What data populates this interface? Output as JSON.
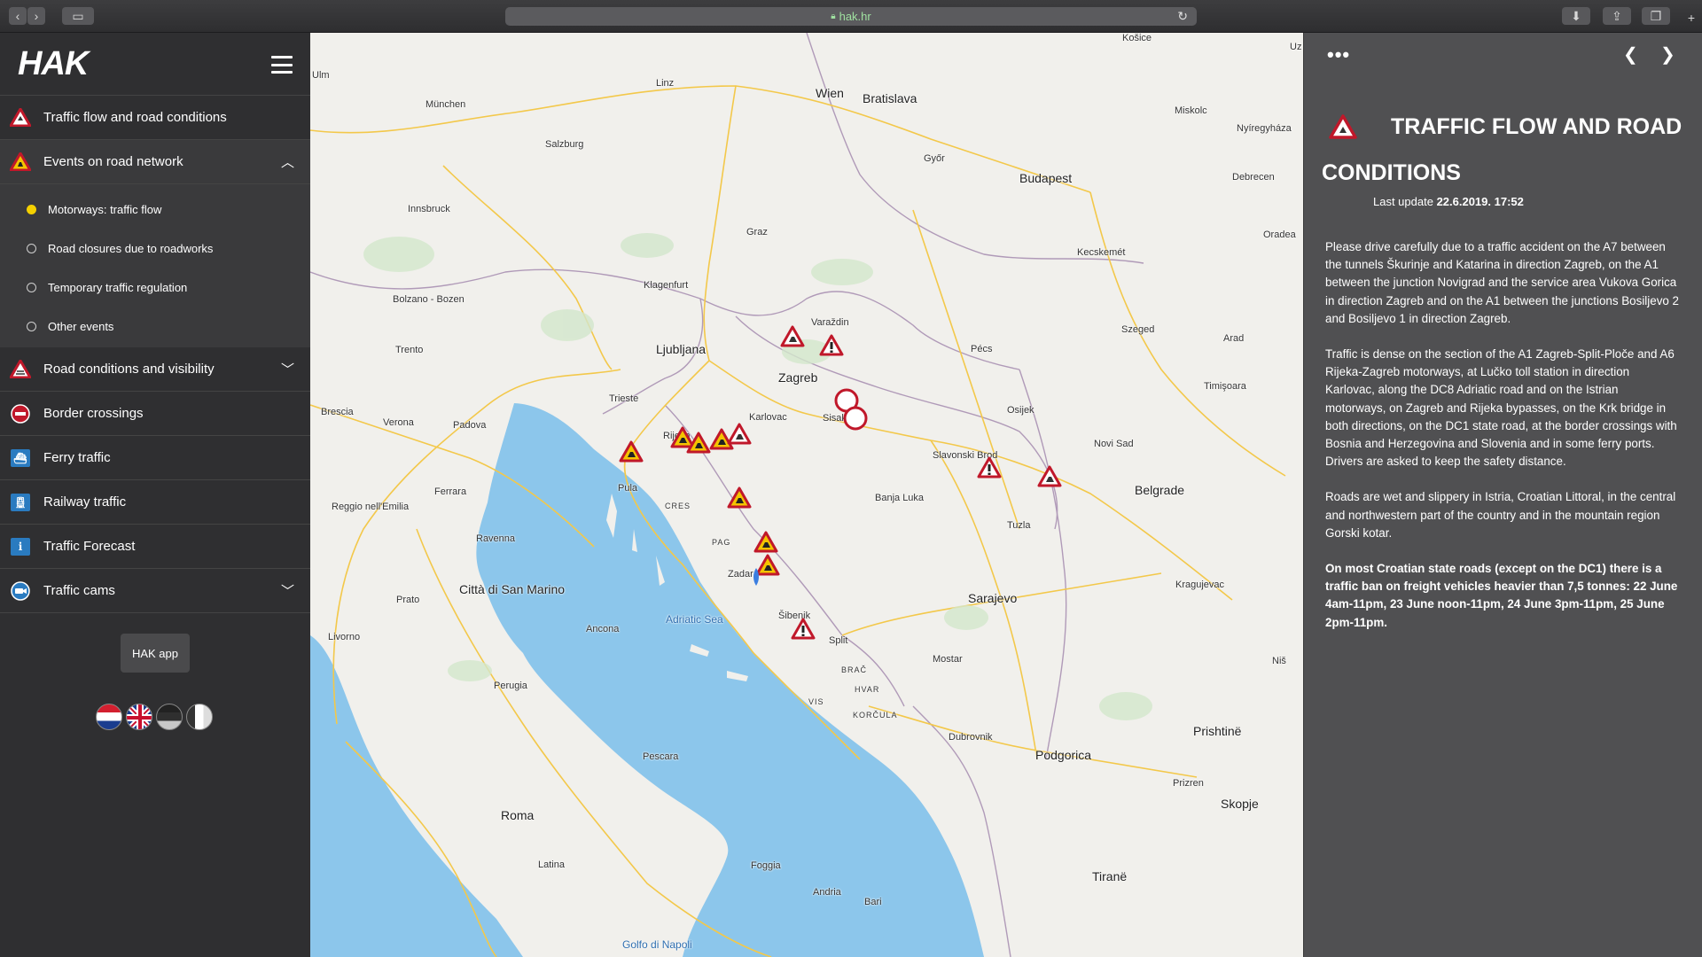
{
  "browser": {
    "url": "hak.hr",
    "icons": [
      "back-icon",
      "forward-icon",
      "sidebar-toggle-icon",
      "lock-icon",
      "reload-icon",
      "download-icon",
      "share-icon",
      "tabs-icon",
      "new-tab-icon"
    ]
  },
  "sidebar": {
    "logo": "HAK",
    "items": [
      {
        "label": "Traffic flow and road conditions",
        "icon": "warning-triangle-icon"
      },
      {
        "label": "Events on road network",
        "icon": "roadworks-icon"
      },
      {
        "label": "Road conditions and visibility",
        "icon": "visibility-icon"
      },
      {
        "label": "Border crossings",
        "icon": "no-entry-icon"
      },
      {
        "label": "Ferry traffic",
        "icon": "ferry-icon"
      },
      {
        "label": "Railway traffic",
        "icon": "train-icon"
      },
      {
        "label": "Traffic Forecast",
        "icon": "info-icon"
      },
      {
        "label": "Traffic cams",
        "icon": "camera-icon"
      }
    ],
    "sub_items": [
      {
        "label": "Motorways: traffic flow",
        "selected": true
      },
      {
        "label": "Road closures due to roadworks",
        "selected": false
      },
      {
        "label": "Temporary traffic regulation",
        "selected": false
      },
      {
        "label": "Other events",
        "selected": false
      }
    ],
    "app_button": "HAK app",
    "languages": [
      "croatian-flag",
      "uk-flag",
      "german-flag",
      "italian-flag"
    ]
  },
  "map": {
    "labels": {
      "wien": "Wien",
      "bratislava": "Bratislava",
      "budapest": "Budapest",
      "munchen": "München",
      "linz": "Linz",
      "salzburg": "Salzburg",
      "innsbruck": "Innsbruck",
      "graz": "Graz",
      "gyor": "Győr",
      "miskolc": "Miskolc",
      "nyiregyhaza": "Nyíregyháza",
      "debrecen": "Debrecen",
      "oradea": "Oradea",
      "kecskemet": "Kecskemét",
      "szeged": "Szeged",
      "arad": "Arad",
      "timisoara": "Timişoara",
      "pecs": "Pécs",
      "osijek": "Osijek",
      "novi_sad": "Novi Sad",
      "belgrade": "Belgrade",
      "klagenfurt": "Klagenfurt",
      "ljubljana": "Ljubljana",
      "varazdin": "Varaždin",
      "zagreb": "Zagreb",
      "sisak": "Sisak",
      "karlovac": "Karlovac",
      "rijeka": "Rijeka",
      "trieste": "Trieste",
      "pula": "Pula",
      "cres": "CRES",
      "pag": "PAG",
      "zadar": "Zadar",
      "sibenik": "Šibenik",
      "split": "Split",
      "brac": "BRAČ",
      "hvar": "HVAR",
      "vis": "VIS",
      "korcula": "KORČULA",
      "dubrovnik": "Dubrovnik",
      "banja_luka": "Banja Luka",
      "tuzla": "Tuzla",
      "sarajevo": "Sarajevo",
      "mostar": "Mostar",
      "slavonski_brod": "Slavonski Brod",
      "kragujevac": "Kragujevac",
      "nis": "Niš",
      "prishtine": "Prishtinë",
      "prizren": "Prizren",
      "skopje": "Skopje",
      "podgorica": "Podgorica",
      "tirane": "Tiranë",
      "bolzano": "Bolzano - Bozen",
      "trento": "Trento",
      "verona": "Verona",
      "brescia": "Brescia",
      "padova": "Padova",
      "ferrara": "Ferrara",
      "reggio": "Reggio nell'Emilia",
      "ravenna": "Ravenna",
      "prato": "Prato",
      "livorno": "Livorno",
      "san_marino": "Città di San Marino",
      "ancona": "Ancona",
      "perugia": "Perugia",
      "adriatic": "Adriatic Sea",
      "pescara": "Pescara",
      "roma": "Roma",
      "latina": "Latina",
      "foggia": "Foggia",
      "andria": "Andria",
      "bari": "Bari",
      "napoli": "Golfo di Napoli",
      "kosice": "Košice",
      "ulm": "Ulm",
      "uz": "Uz"
    },
    "marker_count": 16
  },
  "panel": {
    "title": "TRAFFIC FLOW AND ROAD CONDITIONS",
    "update_label": "Last update",
    "update_value": "22.6.2019. 17:52",
    "paragraphs": [
      "Please drive carefully due to a traffic accident on the A7 between the tunnels Škurinje and Katarina in direction Zagreb, on the A1 between the junction Novigrad and the service area Vukova Gorica in direction Zagreb and on the A1 between the junctions Bosiljevo 2 and Bosiljevo 1 in direction Zagreb.",
      "Traffic is dense on the section of the A1 Zagreb-Split-Ploče and A6 Rijeka-Zagreb motorways, at Lučko toll station in direction Karlovac, along the DC8 Adriatic road and on the Istrian motorways, on Zagreb and Rijeka bypasses, on the Krk bridge in both directions, on the DC1 state road, at the border crossings with Bosnia and Herzegovina and Slovenia and in some ferry ports. Drivers are asked to keep the safety distance.",
      "Roads are wet and slippery in Istria, Croatian Littoral, in the central and northwestern part of the country and in the mountain region Gorski kotar."
    ],
    "bold_paragraph": "On most Croatian state roads (except on the DC1) there is a traffic ban on freight vehicles heavier than 7,5 tonnes: 22 June 4am-11pm, 23 June noon-11pm, 24 June 3pm-11pm, 25 June 2pm-11pm."
  },
  "colors": {
    "sidebar_bg": "#2f2f31",
    "panel_bg": "#505052",
    "sea": "#8cc6eb",
    "accent_yellow": "#f4d000",
    "marker_red": "#c0182a"
  }
}
